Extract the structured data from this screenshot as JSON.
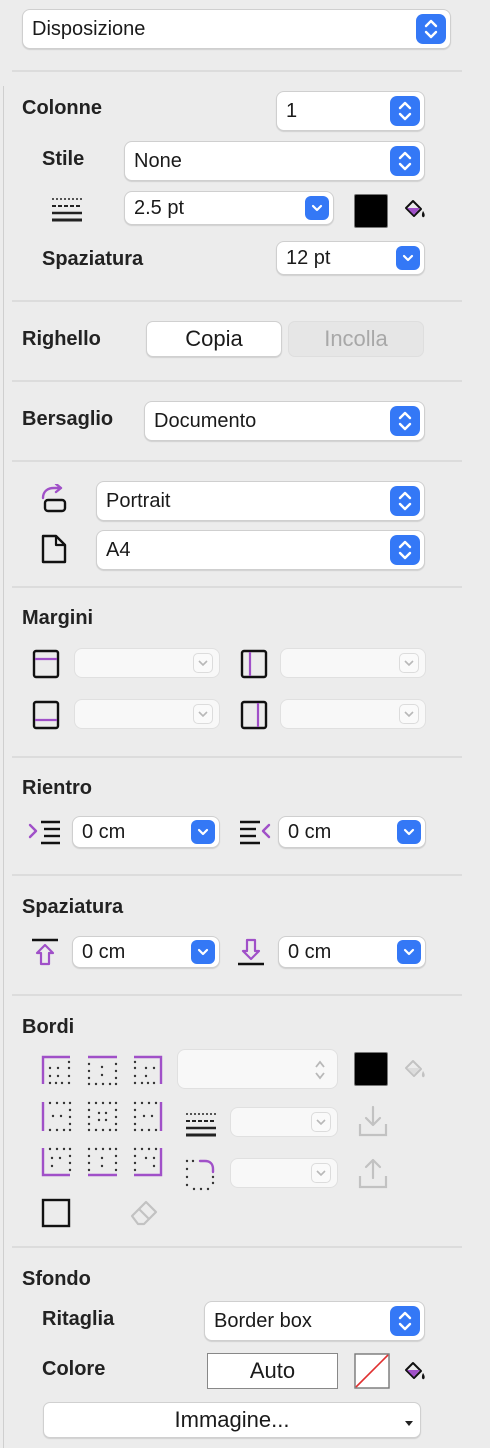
{
  "top_select": {
    "value": "Disposizione"
  },
  "colonne": {
    "label": "Colonne",
    "count": "1",
    "stile_label": "Stile",
    "stile_value": "None",
    "width_value": "2.5 pt",
    "spaziatura_label": "Spaziatura",
    "spaziatura_value": "12 pt"
  },
  "righello": {
    "label": "Righello",
    "copy": "Copia",
    "paste": "Incolla"
  },
  "bersaglio": {
    "label": "Bersaglio",
    "value": "Documento"
  },
  "page": {
    "orientation": "Portrait",
    "size": "A4"
  },
  "margini": {
    "label": "Margini",
    "top": "",
    "left": "",
    "bottom": "",
    "right": ""
  },
  "rientro": {
    "label": "Rientro",
    "left": "0 cm",
    "right": "0 cm"
  },
  "spaziatura": {
    "label": "Spaziatura",
    "before": "0 cm",
    "after": "0 cm"
  },
  "bordi": {
    "label": "Bordi",
    "width": "",
    "style": "",
    "radius": ""
  },
  "sfondo": {
    "label": "Sfondo",
    "ritaglia_label": "Ritaglia",
    "ritaglia_value": "Border box",
    "colore_label": "Colore",
    "colore_value": "Auto",
    "image_button": "Immagine..."
  },
  "colors": {
    "accent": "#3478f6",
    "purple": "#a050c8",
    "swatch": "#000000"
  }
}
